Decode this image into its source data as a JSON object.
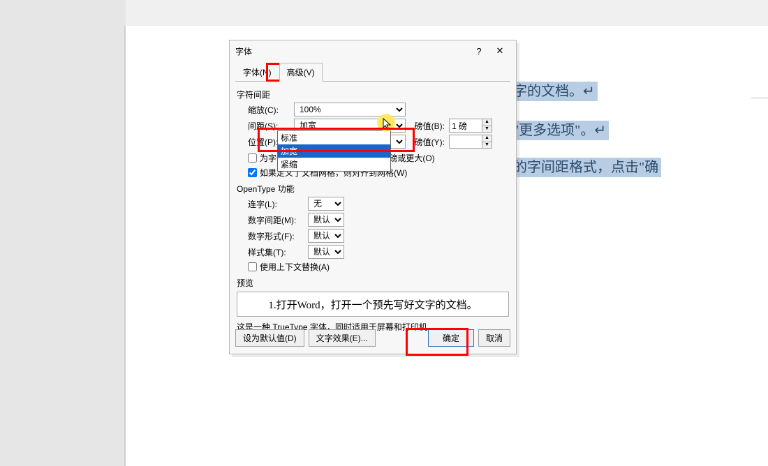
{
  "doc": {
    "line1": "文字的文档。↵",
    "line2": "的\"更多选项\"。↵",
    "line3": "需的字间距格式，点击\"确"
  },
  "dialog": {
    "title": "字体",
    "help": "?",
    "tabs": {
      "font": "字体(N)",
      "advanced": "高级(V)"
    },
    "section_spacing": "字符间距",
    "scale": {
      "label": "缩放(C):",
      "value": "100%"
    },
    "spacing": {
      "label": "间距(S):",
      "value": "加宽",
      "ptlabel": "磅值(B):",
      "ptvalue": "1 磅"
    },
    "position": {
      "label": "位置(P):",
      "value": "标准",
      "ptlabel": "磅值(Y):",
      "ptvalue": ""
    },
    "kerning": {
      "cb": "为字体调整字间距(K):",
      "suffix": "磅或更大(O)",
      "value": ""
    },
    "snapgrid": "如果定义了文档网格，则对齐到网格(W)",
    "section_ot": "OpenType 功能",
    "ligature": {
      "label": "连字(L):",
      "value": "无"
    },
    "numspace": {
      "label": "数字间距(M):",
      "value": "默认"
    },
    "numform": {
      "label": "数字形式(F):",
      "value": "默认"
    },
    "styleset": {
      "label": "样式集(T):",
      "value": "默认"
    },
    "contextalt": "使用上下文替换(A)",
    "preview_label": "预览",
    "preview_text": "1.打开Word，打开一个预先写好文字的文档。",
    "footnote": "这是一种 TrueType 字体，同时适用于屏幕和打印机。",
    "buttons": {
      "setdefault": "设为默认值(D)",
      "texteffect": "文字效果(E)...",
      "ok": "确定",
      "cancel": "取消"
    }
  },
  "dropdown": {
    "opt0": "标准",
    "opt1": "加宽",
    "opt2": "紧缩"
  }
}
